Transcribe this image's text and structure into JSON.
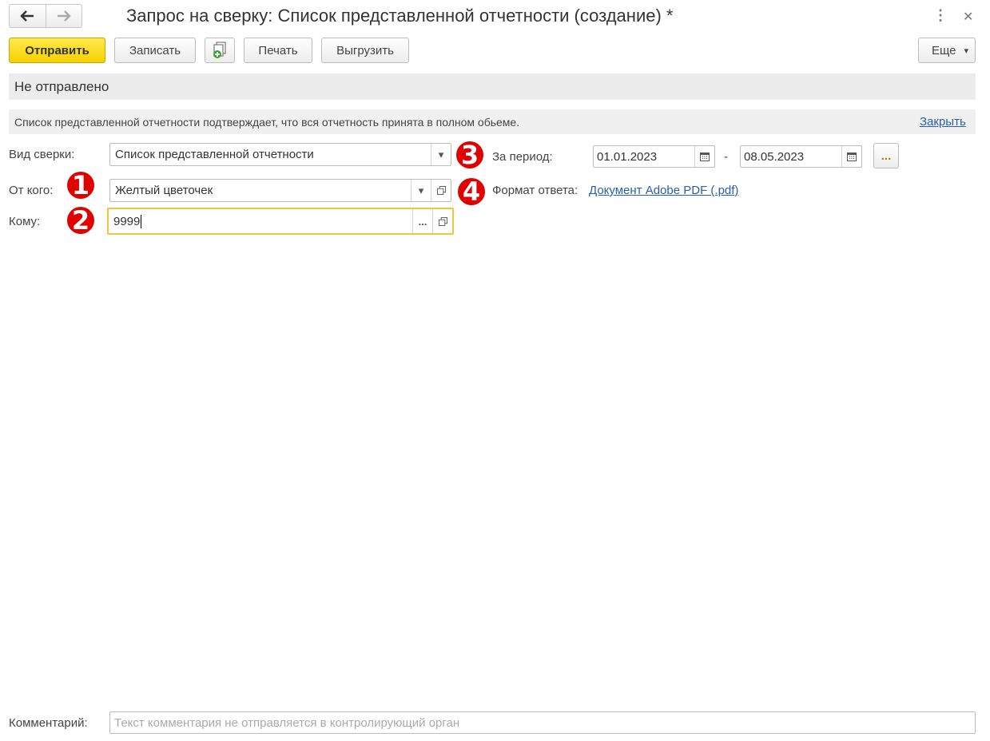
{
  "window": {
    "title": "Запрос на сверку: Список представленной отчетности (создание) *",
    "menu_icon": "⋮",
    "close_icon": "✕"
  },
  "toolbar": {
    "send_label": "Отправить",
    "save_label": "Записать",
    "print_label": "Печать",
    "export_label": "Выгрузить",
    "more_label": "Еще",
    "more_arrow": "▾"
  },
  "status": {
    "text": "Не отправлено"
  },
  "info": {
    "text": "Список представленной отчетности подтверждает, что вся отчетность принята в полном обьеме.",
    "close_link": "Закрыть"
  },
  "form": {
    "kind_label": "Вид сверки:",
    "kind_value": "Список представленной отчетности",
    "from_label": "От кого:",
    "from_value": "Желтый цветочек",
    "to_label": "Кому:",
    "to_value": "9999",
    "period_label": "За период:",
    "period_start": "01.01.2023",
    "period_sep": "-",
    "period_end": "08.05.2023",
    "format_label": "Формат ответа:",
    "format_value": "Документ Adobe PDF (.pdf)",
    "select_dots": "...",
    "dropdown_arrow": "▾"
  },
  "badges": [
    "1",
    "2",
    "3",
    "4"
  ],
  "comment": {
    "label": "Комментарий:",
    "placeholder": "Текст комментария не отправляется в контролирующий орган"
  },
  "colors": {
    "primary_button": "#f5d000",
    "focus_border": "#f5c342",
    "link": "#2a5fb0",
    "badge": "#e00000"
  }
}
